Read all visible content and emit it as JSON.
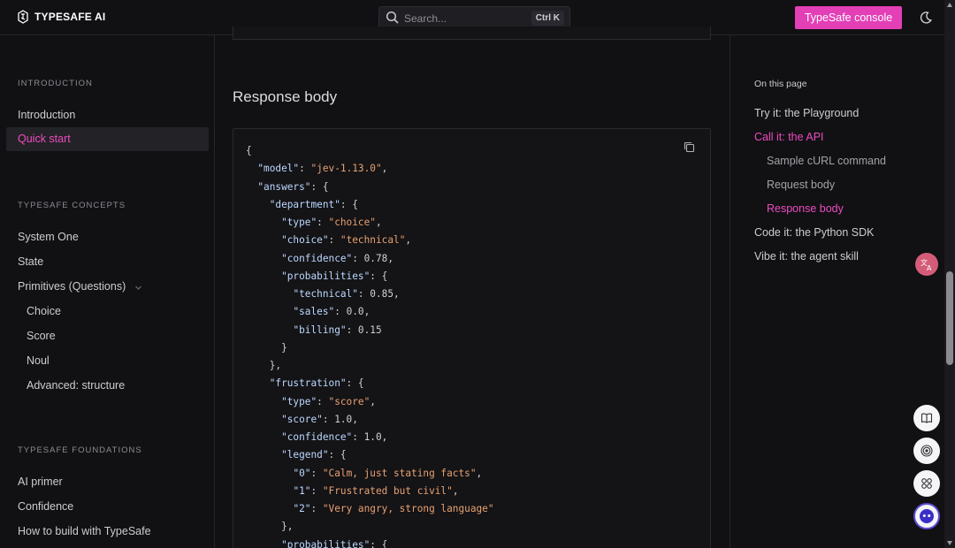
{
  "header": {
    "logo_text": "TYPESAFE AI",
    "search_placeholder": "Search...",
    "search_shortcut": "Ctrl K",
    "console_label": "TypeSafe console"
  },
  "sidebar": {
    "sections": [
      {
        "title": "INTRODUCTION",
        "items": [
          "Introduction",
          "Quick start"
        ]
      },
      {
        "title": "TYPESAFE CONCEPTS",
        "items": [
          "System One",
          "State",
          "Primitives (Questions)",
          "Choice",
          "Score",
          "Noul",
          "Advanced: structure"
        ]
      },
      {
        "title": "TYPESAFE FOUNDATIONS",
        "items": [
          "AI primer",
          "Confidence",
          "How to build with TypeSafe"
        ]
      }
    ],
    "active_item": "Quick start"
  },
  "main": {
    "heading": "Response body",
    "code": {
      "model": "jev-1.13.0",
      "department": {
        "type": "choice",
        "choice": "technical",
        "confidence": "0.78",
        "technical": "0.85",
        "sales": "0.0",
        "billing": "0.15"
      },
      "frustration": {
        "type": "score",
        "score": "1.0",
        "confidence": "1.0",
        "legend_0": "Calm, just stating facts",
        "legend_1": "Frustrated but civil",
        "legend_2": "Very angry, strong language"
      }
    }
  },
  "toc": {
    "title": "On this page",
    "items": [
      "Try it: the Playground",
      "Call it: the API",
      "Sample cURL command",
      "Request body",
      "Response body",
      "Code it: the Python SDK",
      "Vibe it: the agent skill"
    ]
  },
  "colors": {
    "accent": "#e33fb6",
    "background": "#111013",
    "string": "#e7a271",
    "key": "#bcd9ff"
  }
}
